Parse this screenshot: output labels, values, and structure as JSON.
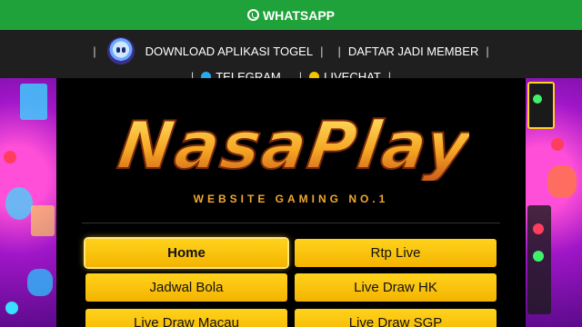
{
  "topbar": {
    "whatsapp_label": "WHATSAPP"
  },
  "nav": {
    "download_label": "DOWNLOAD APLIKASI TOGEL",
    "register_label": "DAFTAR JADI MEMBER",
    "telegram_label": "TELEGRAM",
    "livechat_label": "LIVECHAT",
    "separator": "|"
  },
  "brand": {
    "logo_text": "NasaPlay",
    "tagline": "WEBSITE GAMING NO.1"
  },
  "menu": {
    "items": [
      {
        "label": "Home",
        "active": true
      },
      {
        "label": "Rtp Live",
        "active": false
      },
      {
        "label": "Jadwal Bola",
        "active": false
      },
      {
        "label": "Live Draw HK",
        "active": false
      },
      {
        "label": "Live Draw Macau",
        "active": false
      },
      {
        "label": "Live Draw SGP",
        "active": false
      }
    ]
  },
  "colors": {
    "whatsapp_green": "#1fa23a",
    "button_yellow": "#ffd21c",
    "tagline_orange": "#f0a830",
    "telegram_blue": "#29a9eb",
    "livechat_yellow": "#f5c400"
  }
}
